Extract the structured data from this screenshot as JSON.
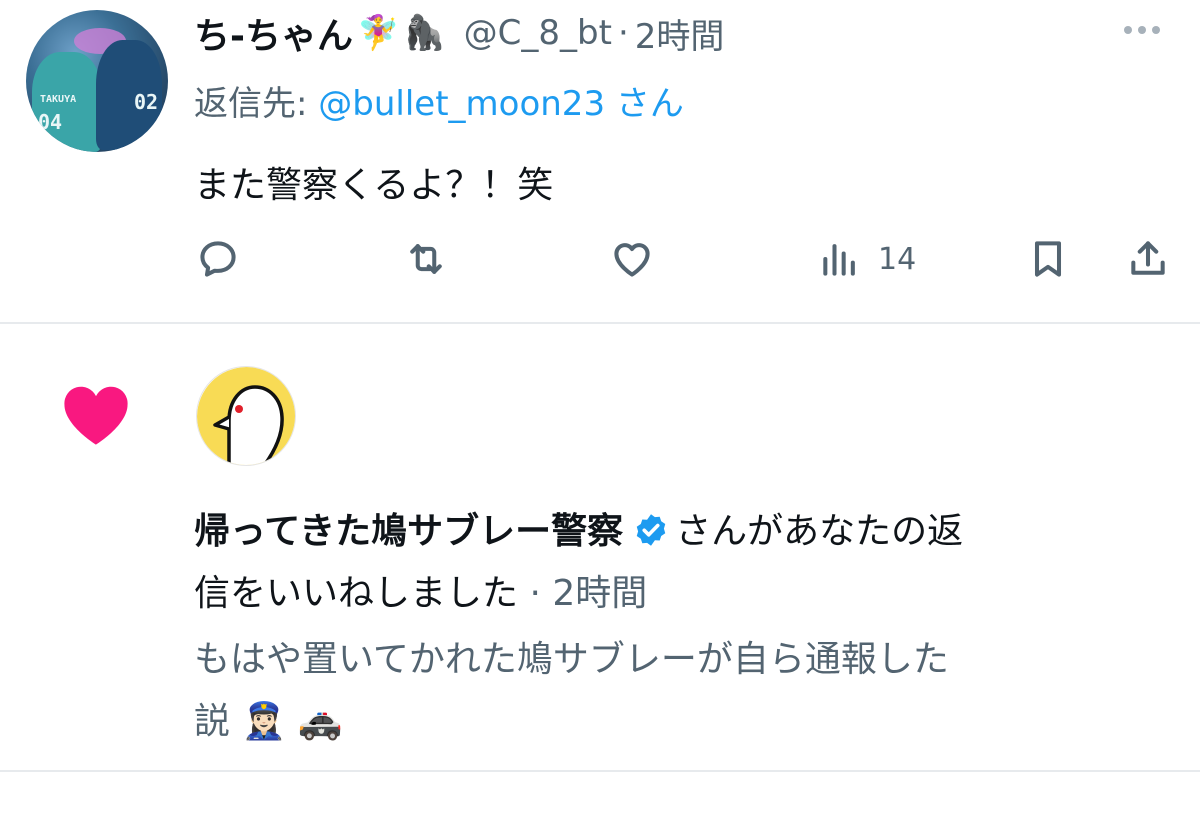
{
  "tweet": {
    "display_name": "ち-ちゃん",
    "name_emojis": [
      "🧚‍♀️",
      "🦍"
    ],
    "handle": "@C_8_bt",
    "separator": "·",
    "time": "2時間",
    "reply_prefix": "返信先: ",
    "reply_to": "@bullet_moon23",
    "reply_suffix": " さん",
    "text": "また警察くるよ？！笑",
    "avatar_jersey_numbers": [
      "04",
      "02"
    ],
    "avatar_jersey_text": "TAKUYA",
    "actions": {
      "reply_icon": "reply-bubble-icon",
      "retweet_icon": "retweet-icon",
      "like_icon": "heart-outline-icon",
      "views_icon": "bar-chart-icon",
      "views_count": "14",
      "bookmark_icon": "bookmark-icon",
      "share_icon": "share-upload-icon"
    }
  },
  "notification": {
    "type_icon": "heart-filled-icon",
    "actor_name": "帰ってきた鳩サブレー警察",
    "verified_icon": "verified-badge-icon",
    "action_text_line1": "さんがあなたの返",
    "action_text_line2": "信をいいねしました",
    "separator": " · ",
    "time": "2時間",
    "preview_line1": "もはや置いてかれた鳩サブレーが自ら通報した",
    "preview_line2_text": "説",
    "preview_line2_emojis": "👮🏻‍♀️ 🚓"
  },
  "colors": {
    "link": "#1d9bf0",
    "muted": "#536471",
    "heart": "#f91880",
    "divider": "#e7eaed",
    "verified": "#1d9bf0"
  }
}
